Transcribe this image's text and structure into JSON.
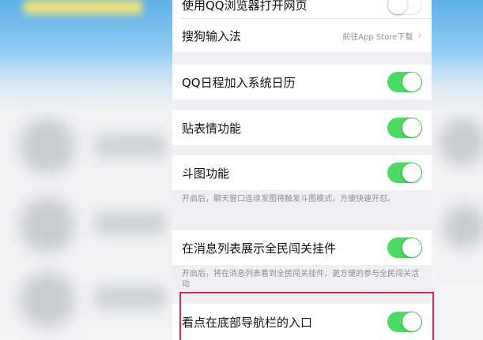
{
  "settings": {
    "qq_browser": {
      "label": "使用QQ浏览器打开网页",
      "enabled": false
    },
    "sogou": {
      "label": "搜狗输入法",
      "action": "前往App Store下载"
    },
    "calendar": {
      "label": "QQ日程加入系统日历",
      "enabled": true
    },
    "stickers": {
      "label": "贴表情功能",
      "enabled": true
    },
    "doutu": {
      "label": "斗图功能",
      "enabled": true,
      "note": "开启后，聊天窗口连续发图将触发斗图模式，方便快速开怼。"
    },
    "pendant": {
      "label": "在消息列表展示全民闯关挂件",
      "enabled": true,
      "note": "开启后，将在消息列表看到全民闯关挂件，更方便的参与全民闯关活动"
    },
    "kandian": {
      "label": "看点在底部导航栏的入口",
      "enabled": true
    }
  },
  "colors": {
    "toggle_on": "#4cd964",
    "highlight": "#d42a4f"
  },
  "icons": {
    "chevron": "chevron-right-icon"
  }
}
